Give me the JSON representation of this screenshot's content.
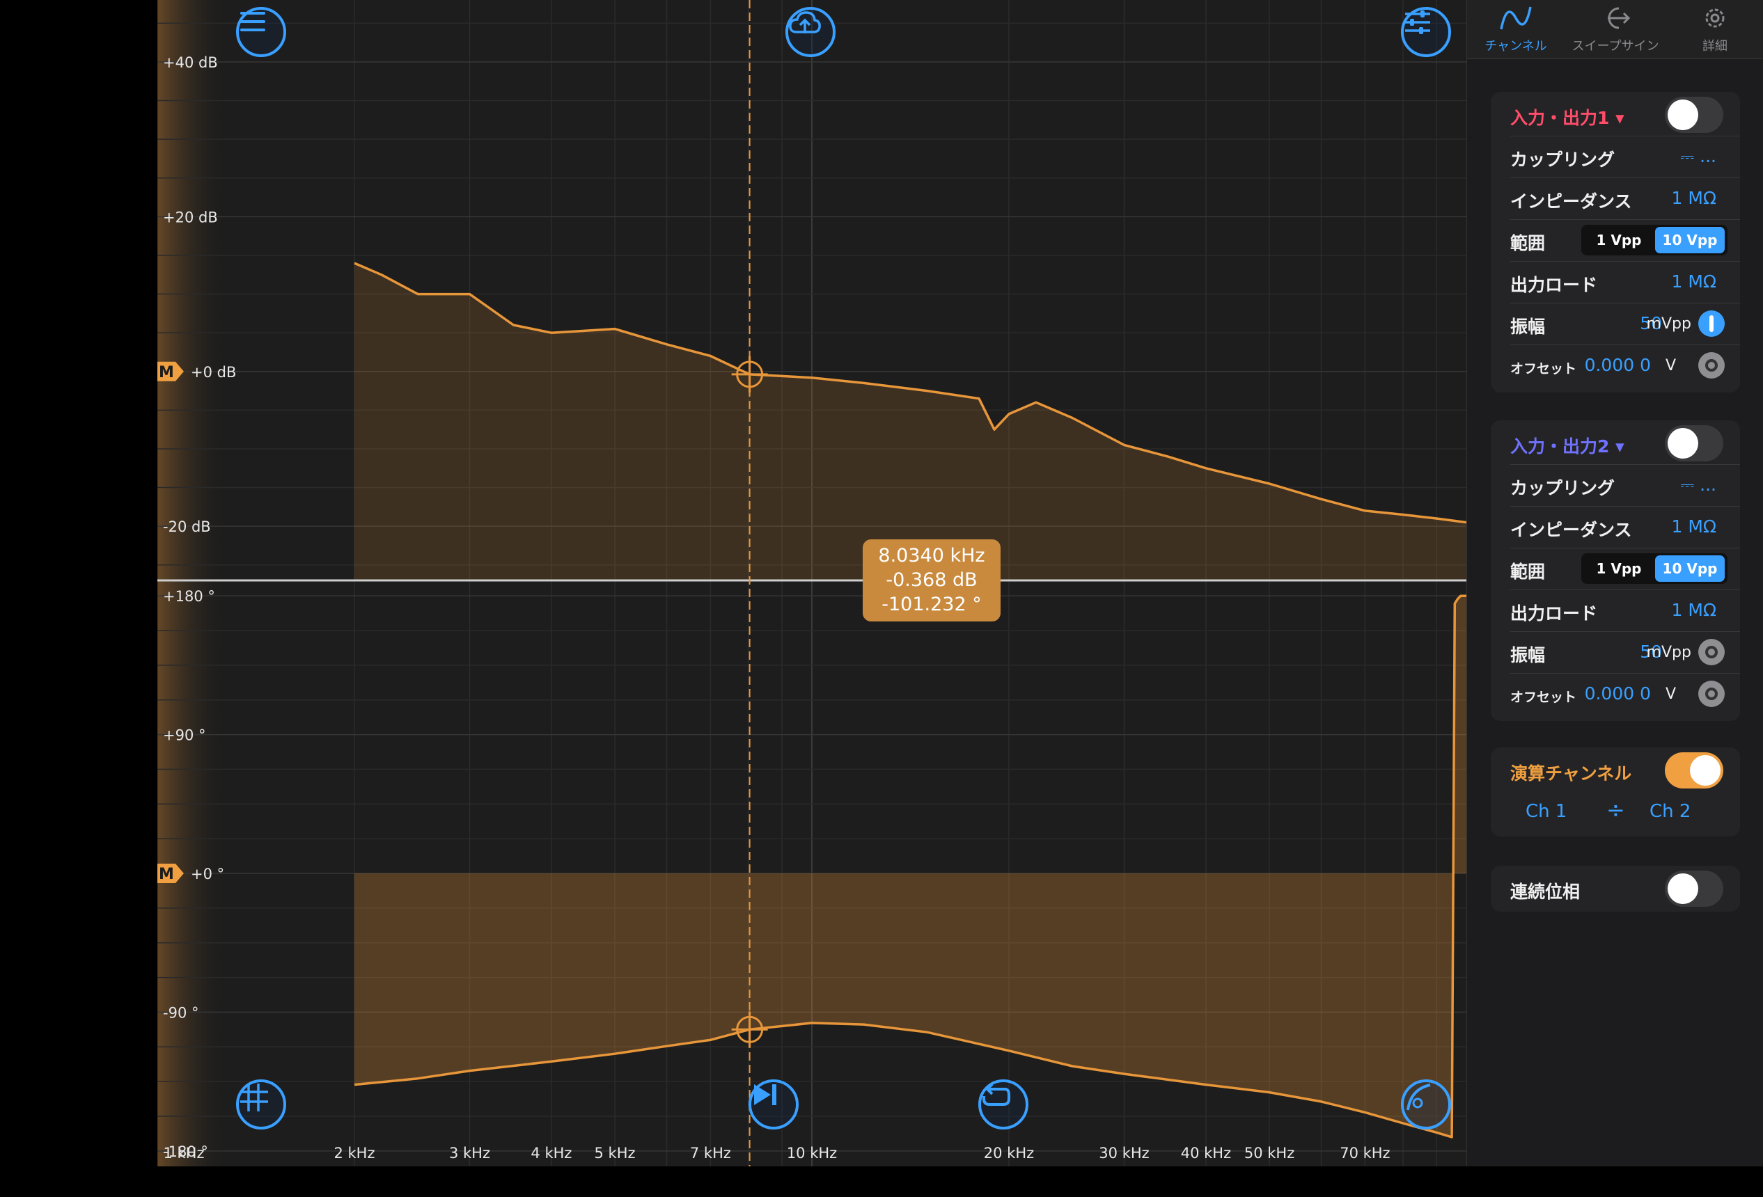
{
  "plot": {
    "y_mag_labels": [
      "+40 dB",
      "+20 dB",
      "+0 dB",
      "-20 dB"
    ],
    "y_phase_labels": [
      "+180 °",
      "+90 °",
      "+0 °",
      "-90 °",
      "-180 °"
    ],
    "x_labels": [
      "1 kHz",
      "2 kHz",
      "3 kHz",
      "4 kHz",
      "5 kHz",
      "7 kHz",
      "10 kHz",
      "20 kHz",
      "30 kHz",
      "40 kHz",
      "50 kHz",
      "70 kHz"
    ],
    "marker_label": "M",
    "cursor": {
      "freq": "8.0340 kHz",
      "mag": "-0.368 dB",
      "phase": "-101.232 °"
    },
    "trace_color": "#e8963a",
    "accent_color": "#3aa0ff"
  },
  "chart_data": [
    {
      "type": "line",
      "title": "",
      "xlabel": "",
      "ylabel": "",
      "x_scale": "log",
      "xlim": [
        1000,
        100000
      ],
      "ylim": [
        -27,
        48
      ],
      "x": [
        2000,
        2200,
        2500,
        3000,
        3500,
        4000,
        5000,
        6000,
        7000,
        8034,
        10000,
        12000,
        15000,
        18000,
        19000,
        20000,
        22000,
        25000,
        30000,
        35000,
        40000,
        50000,
        60000,
        70000,
        80000,
        90000,
        100000
      ],
      "y": [
        14.0,
        12.5,
        10.0,
        10.0,
        6.0,
        5.0,
        5.5,
        3.5,
        2.0,
        -0.368,
        -0.8,
        -1.5,
        -2.5,
        -3.5,
        -7.5,
        -5.5,
        -4.0,
        -6.0,
        -9.5,
        -11.0,
        -12.5,
        -14.5,
        -16.5,
        -18.0,
        -18.5,
        -19.0,
        -19.5
      ]
    },
    {
      "type": "line",
      "title": "",
      "xlabel": "",
      "ylabel": "",
      "x_scale": "log",
      "xlim": [
        1000,
        100000
      ],
      "ylim": [
        -190,
        190
      ],
      "x": [
        2000,
        2500,
        3000,
        4000,
        5000,
        6000,
        7000,
        8034,
        10000,
        12000,
        15000,
        20000,
        25000,
        30000,
        40000,
        50000,
        60000,
        70000,
        80000,
        90000,
        95000,
        96000,
        97000,
        98000,
        100000
      ],
      "y": [
        -137,
        -133,
        -128,
        -122,
        -117,
        -112,
        -108,
        -101.232,
        -97,
        -98,
        -103,
        -115,
        -125,
        -130,
        -137,
        -142,
        -148,
        -155,
        -162,
        -168,
        -171,
        175,
        178,
        180,
        180
      ]
    }
  ],
  "toolbar": {
    "menu": "menu-icon",
    "upload": "cloud-upload-icon",
    "settings": "sliders-icon",
    "grid": "grid-icon",
    "step": "skip-forward-icon",
    "repeat": "repeat-icon",
    "curve": "curve-icon"
  },
  "tabs": [
    {
      "label": "チャンネル",
      "icon": "sine-wave-icon",
      "active": true
    },
    {
      "label": "スイープサイン",
      "icon": "sweep-icon",
      "active": false
    },
    {
      "label": "詳細",
      "icon": "gear-icon",
      "active": false
    }
  ],
  "ch1": {
    "title": "入力・出力1 ▾",
    "title_color": "#ff4d6a",
    "enabled": false,
    "coupling_label": "カップリング",
    "coupling_value": "⎓ ...",
    "impedance_label": "インピーダンス",
    "impedance_value": "1 MΩ",
    "range_label": "範囲",
    "range_options": [
      "1 Vpp",
      "10 Vpp"
    ],
    "range_selected": "10 Vpp",
    "load_label": "出力ロード",
    "load_value": "1 MΩ",
    "amp_label": "振幅",
    "amp_value": "50",
    "amp_unit": "mVpp",
    "offset_label": "オフセット",
    "offset_value": "0.000 0",
    "offset_unit": "V"
  },
  "ch2": {
    "title": "入力・出力2 ▾",
    "title_color": "#6f72ff",
    "enabled": false,
    "coupling_label": "カップリング",
    "coupling_value": "⎓ ...",
    "impedance_label": "インピーダンス",
    "impedance_value": "1 MΩ",
    "range_label": "範囲",
    "range_options": [
      "1 Vpp",
      "10 Vpp"
    ],
    "range_selected": "10 Vpp",
    "load_label": "出力ロード",
    "load_value": "1 MΩ",
    "amp_label": "振幅",
    "amp_value": "50",
    "amp_unit": "mVpp",
    "offset_label": "オフセット",
    "offset_value": "0.000 0",
    "offset_unit": "V"
  },
  "math": {
    "title": "演算チャンネル",
    "title_color": "#f0a040",
    "enabled": true,
    "a": "Ch 1",
    "op": "÷",
    "b": "Ch 2"
  },
  "cont_phase": {
    "label": "連続位相",
    "enabled": false
  }
}
